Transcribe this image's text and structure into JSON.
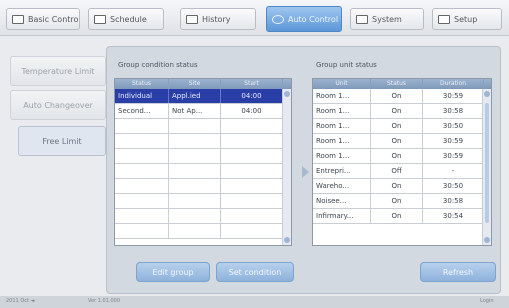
{
  "tabs": [
    {
      "label": "Basic Control",
      "icon": "monitor-icon",
      "active": false
    },
    {
      "label": "Schedule",
      "icon": "calendar-icon",
      "active": false
    },
    {
      "label": "History",
      "icon": "history-icon",
      "active": false
    },
    {
      "label": "Auto Control",
      "icon": "auto-control-icon",
      "active": true
    },
    {
      "label": "System",
      "icon": "system-icon",
      "active": false
    },
    {
      "label": "Setup",
      "icon": "setup-icon",
      "active": false
    }
  ],
  "sidebar": {
    "items": [
      {
        "label": "Temperature Limit"
      },
      {
        "label": "Auto Changeover"
      },
      {
        "label": "Free Limit"
      }
    ]
  },
  "left_table": {
    "title": "Group condition status",
    "columns": [
      "Status",
      "Site",
      "Start"
    ],
    "rows": [
      [
        "Individual",
        "Appl.ied",
        "04:00"
      ],
      [
        "Second...",
        "Not Ap...",
        "04:00"
      ]
    ]
  },
  "right_table": {
    "title": "Group unit status",
    "columns": [
      "Unit",
      "Status",
      "Duration"
    ],
    "rows": [
      [
        "Room 1...",
        "On",
        "30:59"
      ],
      [
        "Room 1...",
        "On",
        "30:58"
      ],
      [
        "Room 1...",
        "On",
        "30:50"
      ],
      [
        "Room 1...",
        "On",
        "30:59"
      ],
      [
        "Room 1...",
        "On",
        "30:59"
      ],
      [
        "Entrepri...",
        "Off",
        "-"
      ],
      [
        "Wareho...",
        "On",
        "30:50"
      ],
      [
        "Noisee...",
        "On",
        "30:58"
      ],
      [
        "Infirmary...",
        "On",
        "30:54"
      ]
    ]
  },
  "buttons": {
    "edit_group": "Edit group",
    "set_condition": "Set condition",
    "refresh": "Refresh"
  },
  "statusbar": {
    "left": "2011 Oct  ◄",
    "mid": "Ver  1.01.000",
    "right": "Login"
  },
  "colors": {
    "accent": "#5c97d8",
    "selected_row": "#2a3ea8",
    "button": "#9dbde3"
  }
}
